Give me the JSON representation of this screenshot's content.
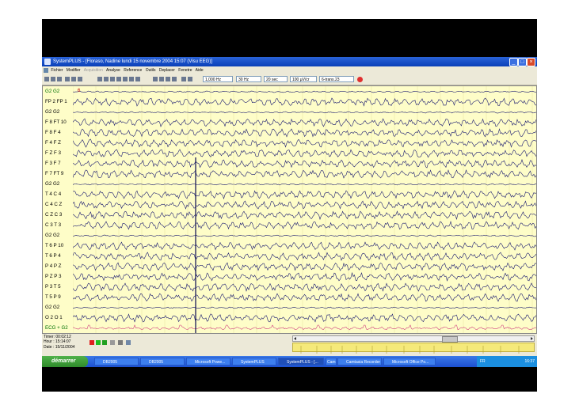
{
  "window": {
    "title": "SystemPLUS - [Floraso, Nadine lundi 15 novembre 2004 15:07 (Visu EEG)]"
  },
  "menu": [
    "Fichier",
    "Modifier",
    "Acquisition",
    "Analyse",
    "Reference",
    "Outils",
    "Deplacer",
    "Fenetre",
    "Aide"
  ],
  "toolbar": {
    "sensitivity": "1,000 Hz",
    "filter": "30 Hz",
    "timebase": "20 sec",
    "amplitude": "100 µV/cr",
    "montage": "6-trans.23"
  },
  "eeg": {
    "marker": "6",
    "channels": [
      "G2 G2",
      "FP 2 FP 1",
      "G2 G2",
      "F 8 FT 10",
      "F 8 F 4",
      "F 4 F Z",
      "F Z F 3",
      "F 3 F 7",
      "F 7 FT 9",
      "G2 G2",
      "T 4 C 4",
      "C 4 C Z",
      "C Z C 3",
      "C 3 T 3",
      "G2 G2",
      "T 6 P 10",
      "T 6 P 4",
      "P 4 P Z",
      "P Z P 3",
      "P 3 T 5",
      "T 5 P 9",
      "G2 G2",
      "O 2 O 1",
      "ECG + G2"
    ]
  },
  "status": {
    "timer": "Timer: 00:02:12",
    "hour": "Hour : 15:14:07",
    "date": "Date : 15/11/2004"
  },
  "taskbar": {
    "start": "démarrer",
    "items": [
      "DB2005",
      "DB2005",
      "Microsoft Powe...",
      "SystemPLUS",
      "SystemPLUS - [...",
      "Camtasia Recorder",
      "Microsoft Office Po..."
    ],
    "extra": "Cam",
    "tray_lang": "FR",
    "clock": "16:37"
  }
}
